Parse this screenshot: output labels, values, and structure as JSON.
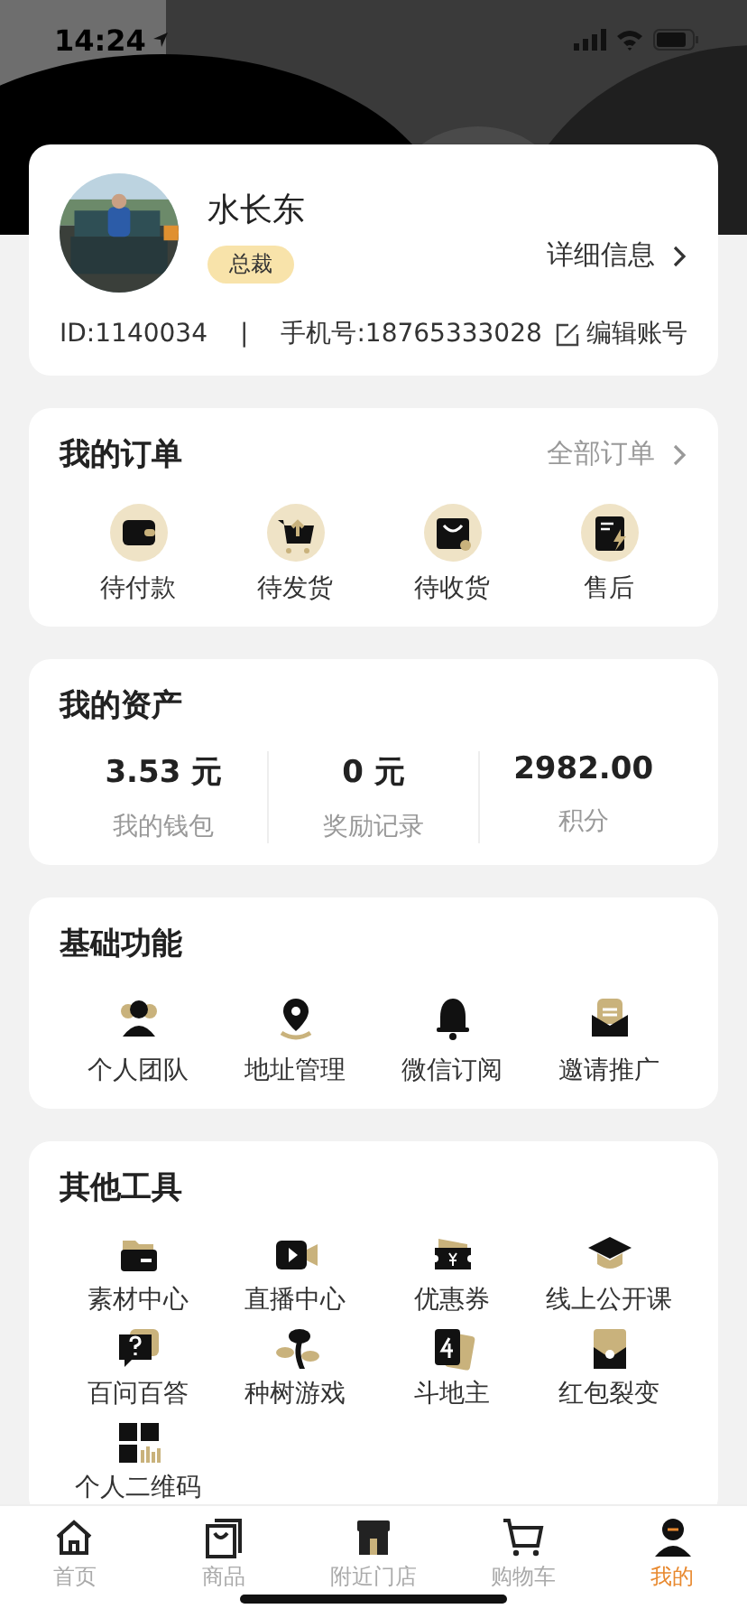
{
  "status_bar": {
    "time": "14:24"
  },
  "profile": {
    "name": "水长东",
    "badge": "总裁",
    "details_link": "详细信息",
    "id": "ID:1140034",
    "separator": "|",
    "phone": "手机号:18765333028",
    "edit_link": "编辑账号"
  },
  "orders": {
    "title": "我的订单",
    "all_link": "全部订单",
    "items": [
      "待付款",
      "待发货",
      "待收货",
      "售后"
    ]
  },
  "assets": {
    "title": "我的资产",
    "items": [
      {
        "value": "3.53 元",
        "label": "我的钱包"
      },
      {
        "value": "0 元",
        "label": "奖励记录"
      },
      {
        "value": "2982.00",
        "label": "积分"
      }
    ]
  },
  "basic": {
    "title": "基础功能",
    "items": [
      "个人团队",
      "地址管理",
      "微信订阅",
      "邀请推广"
    ]
  },
  "tools": {
    "title": "其他工具",
    "items": [
      "素材中心",
      "直播中心",
      "优惠券",
      "线上公开课",
      "百问百答",
      "种树游戏",
      "斗地主",
      "红包裂变",
      "个人二维码"
    ]
  },
  "tab_bar": [
    {
      "label": "首页",
      "selected": false
    },
    {
      "label": "商品",
      "selected": false
    },
    {
      "label": "附近门店",
      "selected": false
    },
    {
      "label": "购物车",
      "selected": false
    },
    {
      "label": "我的",
      "selected": true
    }
  ]
}
